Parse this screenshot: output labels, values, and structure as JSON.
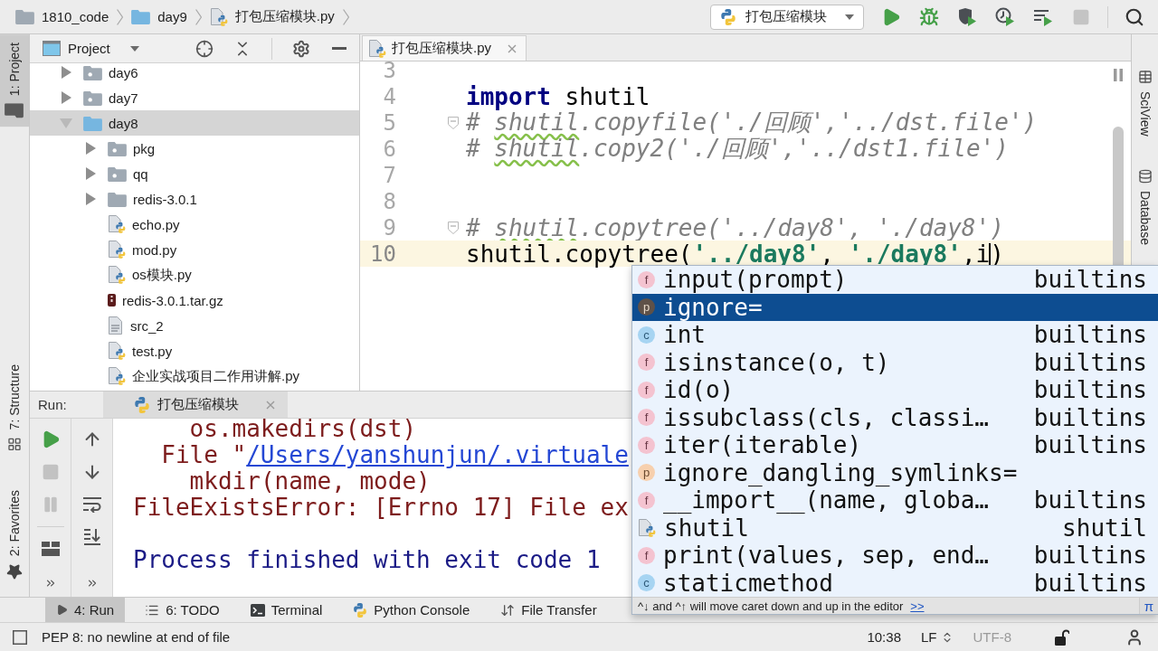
{
  "breadcrumbs": [
    {
      "label": "1810_code",
      "kind": "folder"
    },
    {
      "label": "day9",
      "kind": "source_root"
    },
    {
      "label": "打包压缩模块.py",
      "kind": "python"
    }
  ],
  "toolbar": {
    "run_config": "打包压缩模块",
    "buttons": [
      {
        "kind": "run",
        "disabled": false
      },
      {
        "kind": "debug",
        "disabled": false
      },
      {
        "kind": "coverage",
        "disabled": false
      },
      {
        "kind": "profile",
        "disabled": false
      },
      {
        "kind": "concurrency",
        "disabled": false
      },
      {
        "kind": "stop",
        "disabled": true
      },
      {
        "kind": "search",
        "disabled": false
      }
    ]
  },
  "left_stripe": {
    "top": [
      {
        "label": "1: Project",
        "kind": "project",
        "selected": true
      }
    ],
    "bottom": [
      {
        "label": "7: Structure",
        "kind": "structure",
        "selected": false
      },
      {
        "label": "2: Favorites",
        "kind": "favorites",
        "selected": false
      }
    ]
  },
  "right_stripe": [
    {
      "label": "SciView",
      "kind": "sciview",
      "selected": false
    },
    {
      "label": "Database",
      "kind": "database",
      "selected": false
    }
  ],
  "project": {
    "title": "Project",
    "tree": [
      {
        "name": "day6",
        "kind": "package",
        "expanded": false,
        "selected": false
      },
      {
        "name": "day7",
        "kind": "package",
        "expanded": false,
        "selected": false
      },
      {
        "name": "day8",
        "kind": "source_root",
        "expanded": true,
        "selected": true,
        "children": [
          {
            "name": "pkg",
            "kind": "package",
            "expanded": false,
            "selected": false
          },
          {
            "name": "qq",
            "kind": "package",
            "expanded": false,
            "selected": false
          },
          {
            "name": "redis-3.0.1",
            "kind": "folder",
            "expanded": false,
            "selected": false
          },
          {
            "name": "echo.py",
            "kind": "python",
            "selected": false
          },
          {
            "name": "mod.py",
            "kind": "python",
            "selected": false
          },
          {
            "name": "os模块.py",
            "kind": "python",
            "selected": false
          },
          {
            "name": "redis-3.0.1.tar.gz",
            "kind": "archive",
            "selected": false
          },
          {
            "name": "src_2",
            "kind": "text",
            "selected": false
          },
          {
            "name": "test.py",
            "kind": "python",
            "selected": false
          },
          {
            "name": "企业实战项目二作用讲解.py",
            "kind": "python",
            "selected": false
          }
        ]
      }
    ]
  },
  "editor": {
    "tab": {
      "label": "打包压缩模块.py",
      "selected": true
    },
    "lines": [
      {
        "number": "3",
        "current": false,
        "fold": false
      },
      {
        "number": "4",
        "current": false,
        "fold": false,
        "tokens": [
          {
            "kind": "keyword",
            "text": "import"
          },
          {
            "kind": "plain",
            "text": " shutil"
          }
        ]
      },
      {
        "number": "5",
        "current": false,
        "fold": true,
        "tokens": [
          {
            "kind": "comment",
            "text": "# "
          },
          {
            "kind": "typo",
            "text": "shutil"
          },
          {
            "kind": "comment",
            "text": ".copyfile('./回顾','../dst.file')"
          }
        ]
      },
      {
        "number": "6",
        "current": false,
        "fold": false,
        "tokens": [
          {
            "kind": "comment",
            "text": "# "
          },
          {
            "kind": "typo",
            "text": "shutil"
          },
          {
            "kind": "comment",
            "text": ".copy2('./回顾','../dst1.file')"
          }
        ]
      },
      {
        "number": "7",
        "current": false,
        "fold": false
      },
      {
        "number": "8",
        "current": false,
        "fold": false
      },
      {
        "number": "9",
        "current": false,
        "fold": true,
        "tokens": [
          {
            "kind": "comment",
            "text": "# "
          },
          {
            "kind": "typo",
            "text": "shutil"
          },
          {
            "kind": "comment",
            "text": ".copytree('../day8', './day8')"
          }
        ]
      },
      {
        "number": "10",
        "current": true,
        "fold": false,
        "tokens": [
          {
            "kind": "plain",
            "text": "shutil.copytree("
          },
          {
            "kind": "string",
            "text": "'../day8'"
          },
          {
            "kind": "plain",
            "text": ", "
          },
          {
            "kind": "string",
            "text": "'./day8'"
          },
          {
            "kind": "plain",
            "text": ",i"
          },
          {
            "kind": "caret"
          },
          {
            "kind": "plain",
            "text": ")"
          }
        ]
      }
    ]
  },
  "completion": {
    "items": [
      {
        "name": "input(prompt)",
        "kind": "function",
        "badge": "f",
        "source": "builtins",
        "selected": false
      },
      {
        "name": "ignore=",
        "kind": "parameter",
        "badge": "p",
        "selected": true
      },
      {
        "name": "int",
        "kind": "class",
        "badge": "c",
        "source": "builtins",
        "selected": false
      },
      {
        "name": "isinstance(o, t)",
        "kind": "function",
        "badge": "f",
        "source": "builtins",
        "selected": false
      },
      {
        "name": "id(o)",
        "kind": "function",
        "badge": "f",
        "source": "builtins",
        "selected": false
      },
      {
        "name": "issubclass(cls, classi…",
        "kind": "function",
        "badge": "f",
        "source": "builtins",
        "selected": false
      },
      {
        "name": "iter(iterable)",
        "kind": "function",
        "badge": "f",
        "source": "builtins",
        "selected": false
      },
      {
        "name": "ignore_dangling_symlinks=",
        "kind": "parameter",
        "badge": "p",
        "selected": false
      },
      {
        "name": "__import__(name, globa…",
        "kind": "function",
        "badge": "f",
        "source": "builtins",
        "selected": false
      },
      {
        "name": "shutil",
        "kind": "module",
        "source": "shutil",
        "selected": false
      },
      {
        "name": "print(values, sep, end…",
        "kind": "function",
        "badge": "f",
        "source": "builtins",
        "selected": false
      },
      {
        "name": "staticmethod",
        "kind": "class",
        "badge": "c",
        "source": "builtins",
        "selected": false
      }
    ],
    "hint": "^↓ and ^↑ will move caret down and up in the editor",
    "hint_link": ">>",
    "symbol": "π"
  },
  "run_panel": {
    "title": "Run:",
    "tab": {
      "label": "打包压缩模块",
      "selected": true
    },
    "actions": [
      {
        "kind": "rerun",
        "disabled": false
      },
      {
        "kind": "stop",
        "disabled": true
      },
      {
        "kind": "pause",
        "disabled": true
      },
      {
        "kind": "layout",
        "disabled": false
      },
      {
        "kind": "more",
        "disabled": false
      }
    ],
    "navigation": [
      {
        "kind": "up",
        "disabled": false
      },
      {
        "kind": "down",
        "disabled": false
      },
      {
        "kind": "soft_wrap",
        "disabled": false
      },
      {
        "kind": "scroll_end",
        "disabled": false
      },
      {
        "kind": "more",
        "disabled": false
      }
    ],
    "console": [
      {
        "kind": "source",
        "text": "os.makedirs(dst)"
      },
      {
        "kind": "frame",
        "text": "File \"",
        "link": "/Users/yanshunjun/.virtuale"
      },
      {
        "kind": "source",
        "text": "mkdir(name, mode)"
      },
      {
        "kind": "error",
        "text": "FileExistsError: [Errno 17] File ex"
      },
      {
        "kind": "exit",
        "text": "Process finished with exit code 1"
      }
    ]
  },
  "tool_windows": [
    {
      "label": "4: Run",
      "kind": "run",
      "selected": true
    },
    {
      "label": "6: TODO",
      "kind": "todo",
      "selected": false
    },
    {
      "label": "Terminal",
      "kind": "terminal",
      "selected": false
    },
    {
      "label": "Python Console",
      "kind": "python_console",
      "selected": false
    },
    {
      "label": "File Transfer",
      "kind": "transfer",
      "selected": false
    }
  ],
  "status_bar": {
    "message": "PEP 8: no newline at end of file",
    "widgets": [
      {
        "label": "10:38",
        "kind": "text",
        "disabled": false
      },
      {
        "label": "LF",
        "kind": "dropdown",
        "disabled": false
      },
      {
        "label": "UTF-8",
        "kind": "text",
        "disabled": true
      }
    ]
  }
}
